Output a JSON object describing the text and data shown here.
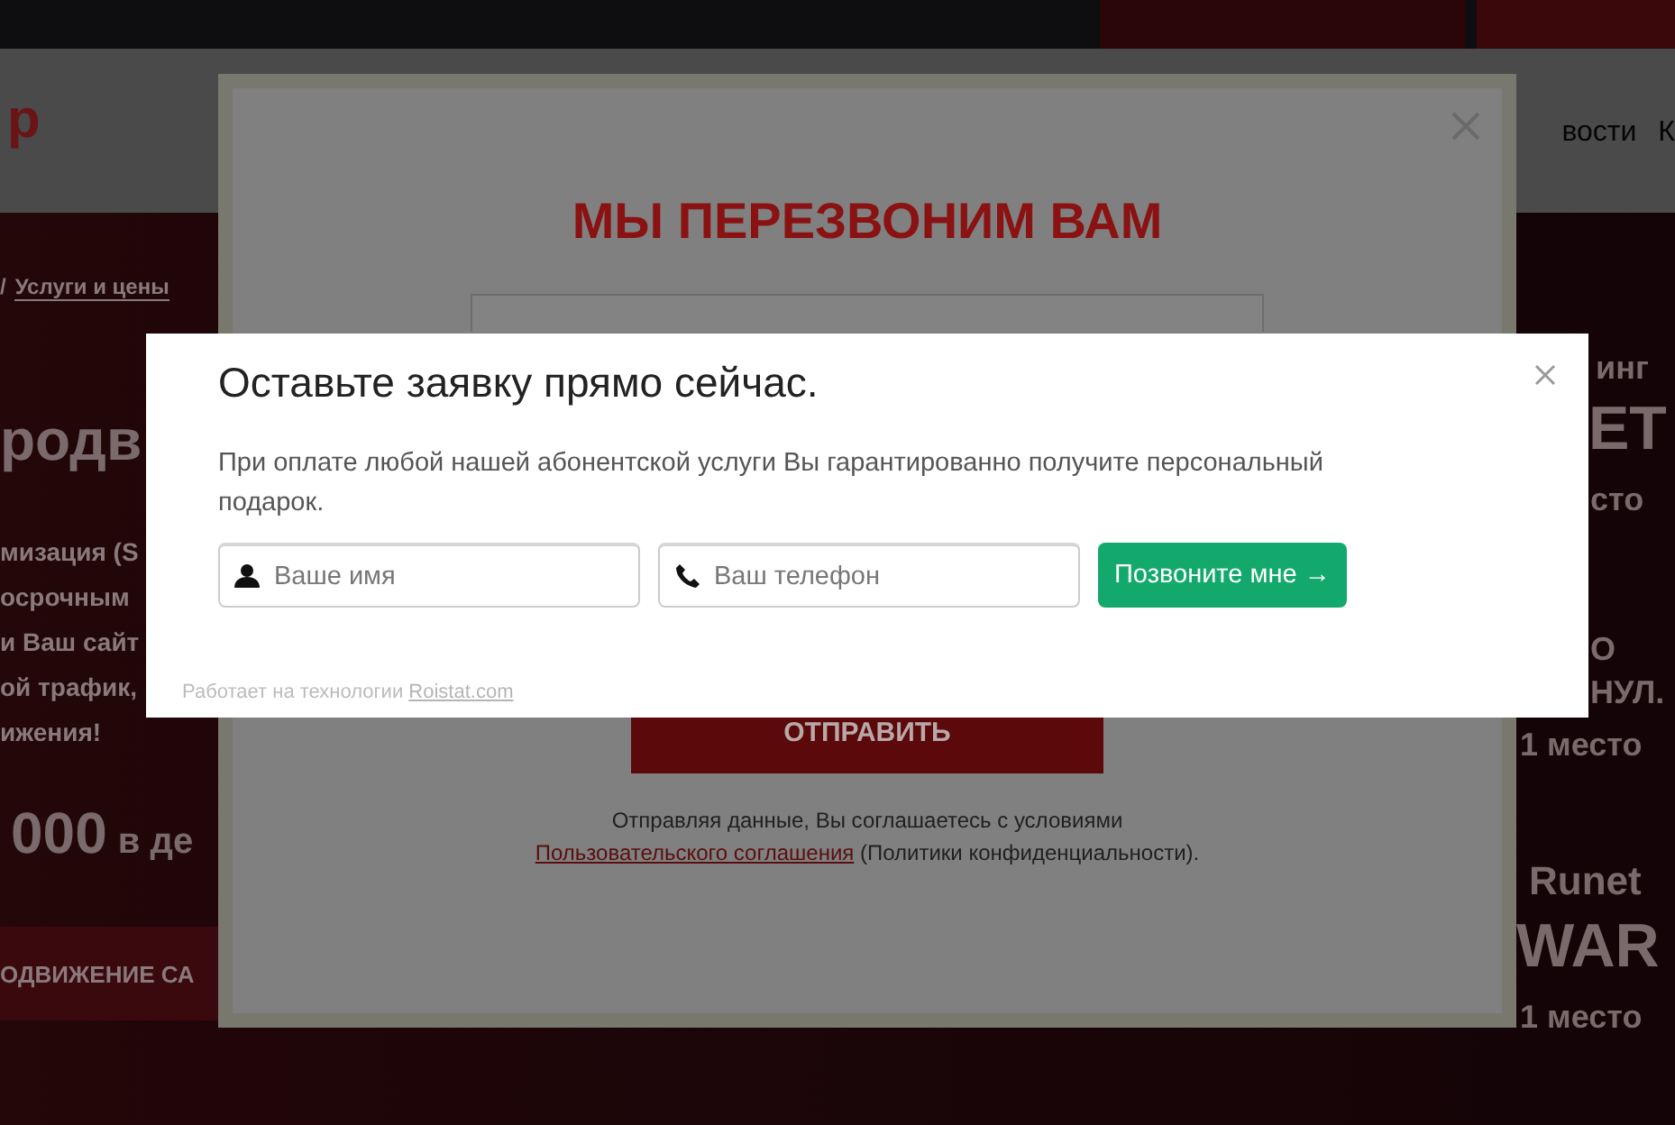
{
  "background_page": {
    "logo": "p",
    "nav_items": [
      "вости",
      "К"
    ],
    "breadcrumb": {
      "separator": "/",
      "current": "Услуги и цены"
    },
    "hero_title": "родв",
    "hero_lines": [
      "мизация (S",
      "осрочным",
      "и Ваш сайт",
      "ой трафик,",
      "ижения!"
    ],
    "price": {
      "amount": "000",
      "suffix": "в де"
    },
    "cta_button": "ОДВИЖЕНИЕ СА",
    "awards": [
      {
        "kind": "small",
        "text": "инг"
      },
      {
        "kind": "big",
        "text": "ЕТ"
      },
      {
        "kind": "small",
        "text": "сто"
      },
      {
        "kind": "small",
        "text": "О"
      },
      {
        "kind": "small",
        "text": "НУЛ."
      },
      {
        "kind": "small",
        "text": "1 место"
      },
      {
        "kind": "medium",
        "text": "Runet"
      },
      {
        "kind": "big",
        "text": "WAR"
      },
      {
        "kind": "small",
        "text": "1 место"
      }
    ]
  },
  "callback_modal": {
    "title": "МЫ ПЕРЕЗВОНИМ ВАМ",
    "submit_button": "ОТПРАВИТЬ",
    "agreement": {
      "text": "Отправляя данные, Вы соглашаетесь с условиями",
      "link": "Пользовательского соглашения",
      "suffix": "(Политики конфиденциальности)."
    }
  },
  "lead_modal": {
    "title": "Оставьте заявку прямо сейчас.",
    "description": "При оплате любой нашей абонентской услуги Вы гарантированно получите персональный подарок.",
    "fields": [
      {
        "kind": "name",
        "placeholder": "Ваше имя"
      },
      {
        "kind": "phone",
        "placeholder": "Ваш телефон"
      }
    ],
    "submit_button": "Позвоните мне →",
    "footer": {
      "text": "Работает на технологии",
      "link": "Roistat.com"
    }
  }
}
